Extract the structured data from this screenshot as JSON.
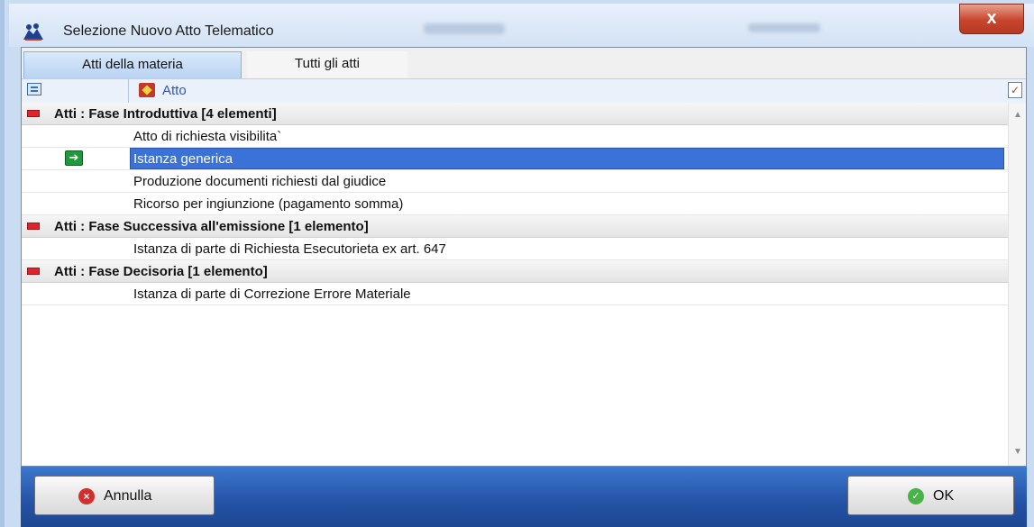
{
  "window": {
    "title": "Selezione Nuovo Atto Telematico",
    "close_glyph": "x"
  },
  "tabs": [
    {
      "label": "Atti della materia",
      "active": true
    },
    {
      "label": "Tutti gli atti",
      "active": false
    }
  ],
  "header": {
    "column_label": "Atto",
    "column_icon": "atto-icon",
    "tree_icon": "tree-view-icon",
    "chooser_icon": "column-chooser-icon"
  },
  "groups": [
    {
      "label": "Atti : Fase Introduttiva  [4 elementi]",
      "items": [
        {
          "label": "Atto di richiesta visibilita`",
          "selected": false
        },
        {
          "label": "Istanza generica",
          "selected": true
        },
        {
          "label": "Produzione documenti richiesti dal giudice",
          "selected": false
        },
        {
          "label": "Ricorso per ingiunzione (pagamento somma)",
          "selected": false
        }
      ]
    },
    {
      "label": "Atti : Fase Successiva all'emissione  [1 elemento]",
      "items": [
        {
          "label": "Istanza di parte di Richiesta Esecutorieta ex art. 647",
          "selected": false
        }
      ]
    },
    {
      "label": "Atti : Fase Decisoria  [1 elemento]",
      "items": [
        {
          "label": "Istanza di parte di Correzione Errore Materiale",
          "selected": false
        }
      ]
    }
  ],
  "buttons": {
    "cancel_label": "Annulla",
    "ok_label": "OK"
  },
  "colors": {
    "selection": "#3b72d8",
    "bottom_bar": "#2452a6",
    "group_marker": "#e0242b"
  }
}
